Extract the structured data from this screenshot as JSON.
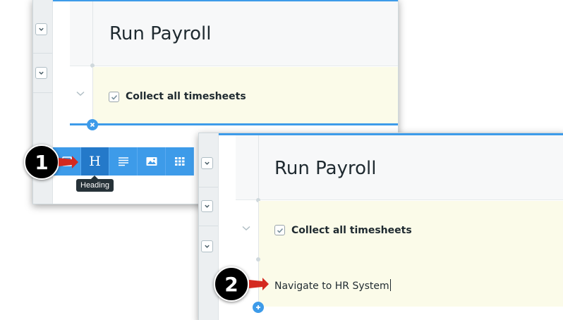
{
  "panel_before": {
    "title": "Run Payroll",
    "step": {
      "label": "Collect all timesheets",
      "checked": true
    },
    "remove_icon": "close-circle-icon",
    "toolbar": {
      "buttons": [
        {
          "name": "text-block",
          "icon": "text-block-icon",
          "label": ""
        },
        {
          "name": "heading",
          "icon": "heading-icon",
          "label": "H",
          "active": true
        },
        {
          "name": "paragraph",
          "icon": "paragraph-icon",
          "label": ""
        },
        {
          "name": "image",
          "icon": "image-icon",
          "label": ""
        },
        {
          "name": "table",
          "icon": "grid-icon",
          "label": ""
        }
      ],
      "tooltip": "Heading"
    }
  },
  "panel_after": {
    "title": "Run Payroll",
    "step": {
      "label": "Collect all timesheets",
      "checked": true
    },
    "new_step_input": "Navigate to HR System",
    "add_icon": "plus-circle-icon"
  },
  "callouts": {
    "first": "1",
    "second": "2"
  },
  "colors": {
    "accent": "#3d9be9",
    "accent_active": "#2479c9",
    "step_bg": "#fbfbe9",
    "arrow": "#d42a20"
  }
}
